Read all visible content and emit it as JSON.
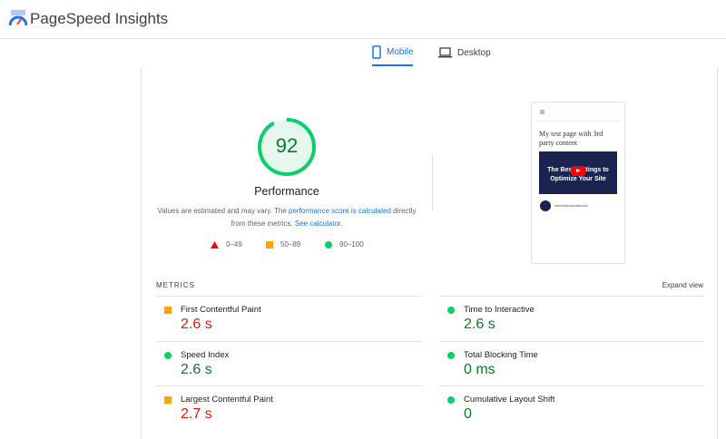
{
  "header": {
    "title": "PageSpeed Insights"
  },
  "tabs": [
    {
      "label": "Mobile",
      "active": true
    },
    {
      "label": "Desktop",
      "active": false
    }
  ],
  "summary": {
    "score": "92",
    "score_fraction": 0.92,
    "category": "Performance",
    "desc_prefix": "Values are estimated and may vary. The ",
    "desc_link": "performance score is calculated",
    "desc_mid": " directly from these metrics. ",
    "calc_link": "See calculator."
  },
  "legend": [
    {
      "range": "0–49",
      "color": "#eb0f00"
    },
    {
      "range": "50–89",
      "color": "#ffa400"
    },
    {
      "range": "90–100",
      "color": "#0cce6b"
    }
  ],
  "thumbnail": {
    "heading": "My test page with 3rd party content",
    "video_title": "The Best Settings to Optimize Your Site",
    "caption": "wonderfulsandbeach"
  },
  "metrics": {
    "heading": "METRICS",
    "expand": "Expand view",
    "items": [
      {
        "label": "First Contentful Paint",
        "value": "2.6 s",
        "status": "average"
      },
      {
        "label": "Time to Interactive",
        "value": "2.6 s",
        "status": "good"
      },
      {
        "label": "Speed Index",
        "value": "2.6 s",
        "status": "good"
      },
      {
        "label": "Total Blocking Time",
        "value": "0 ms",
        "status": "good"
      },
      {
        "label": "Largest Contentful Paint",
        "value": "2.7 s",
        "status": "average"
      },
      {
        "label": "Cumulative Layout Shift",
        "value": "0",
        "status": "good"
      }
    ]
  }
}
